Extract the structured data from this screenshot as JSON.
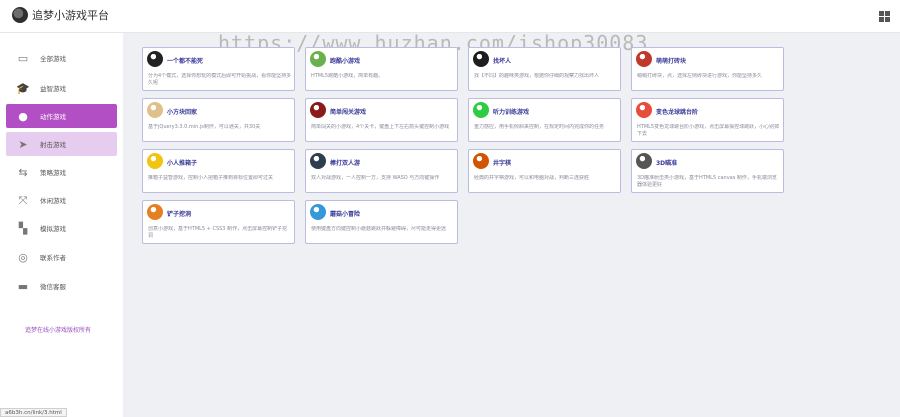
{
  "app": {
    "title": "追梦小游戏平台"
  },
  "watermark": "https://www.huzhan.com/ishop30083",
  "sidebar": {
    "items": [
      {
        "label": "全部游戏",
        "icon": "chat-bubble-icon",
        "glyph": "▭"
      },
      {
        "label": "益智游戏",
        "icon": "graduation-cap-icon",
        "glyph": "🎓"
      },
      {
        "label": "动作游戏",
        "icon": "alien-icon",
        "glyph": "●"
      },
      {
        "label": "射击游戏",
        "icon": "rocket-icon",
        "glyph": "➤"
      },
      {
        "label": "策略游戏",
        "icon": "swap-icon",
        "glyph": "⇆"
      },
      {
        "label": "休闲游戏",
        "icon": "cross-icon",
        "glyph": "⤧"
      },
      {
        "label": "模拟游戏",
        "icon": "blocks-icon",
        "glyph": "▚"
      },
      {
        "label": "联系作者",
        "icon": "user-icon",
        "glyph": "◎"
      },
      {
        "label": "微信客服",
        "icon": "keyboard-icon",
        "glyph": "▬"
      }
    ],
    "active_index": 2,
    "hover_index": 3,
    "footer": "追梦在线小游戏版权所有"
  },
  "games": [
    {
      "title": "一个都不能死",
      "desc": "分为4个模式，选择你想玩的模式后即可开始挑战，看你能坚持多久呢",
      "color": "#222222",
      "icon": "stickman-icon"
    },
    {
      "title": "跑酷小游戏",
      "desc": "HTML5跑酷小游戏，简单有趣。",
      "color": "#6ab04c",
      "icon": "runner-icon"
    },
    {
      "title": "找坏人",
      "desc": "找【不同】的趣味类游戏，根据你仔细的观察力找出坏人",
      "color": "#1e1e1e",
      "icon": "badguy-icon"
    },
    {
      "title": "萌萌打砖块",
      "desc": "萌萌打砖块，点，选择左侧砖块进行游戏，你能坚持多久",
      "color": "#c0392b",
      "icon": "brick-icon"
    },
    {
      "title": "小方块回家",
      "desc": "基于jQuery3.3.0.min.js制作，可以通关，共30关",
      "color": "#e0c08a",
      "icon": "cube-icon"
    },
    {
      "title": "简单闯关游戏",
      "desc": "简单闯关的小游戏，4个关卡，键盘上下左右箭头键控制小游戏",
      "color": "#8b1a1a",
      "icon": "stage-icon"
    },
    {
      "title": "听力训练游戏",
      "desc": "重力感应，用手机倾斜来控制，在规定时间内完成你的任务",
      "color": "#2ecc40",
      "icon": "ear-icon"
    },
    {
      "title": "变色龙球跳台阶",
      "desc": "HTML5变色龙球跳台阶小游戏，点击屏幕操控球跳跃，小心别掉下去",
      "color": "#e74c3c",
      "icon": "ball-icon"
    },
    {
      "title": "小人推箱子",
      "desc": "推箱子益智游戏，控制小人把箱子推到目标位置即可过关",
      "color": "#f1c40f",
      "icon": "worker-icon"
    },
    {
      "title": "棒打双人游",
      "desc": "双人对战游戏，一人控制一方，支持 WASD 与方向键操作",
      "color": "#2c3e50",
      "icon": "bat-icon"
    },
    {
      "title": "井字棋",
      "desc": "经典的井字棋游戏，可以和电脑对战，判断三连获胜",
      "color": "#d35400",
      "icon": "grid-icon"
    },
    {
      "title": "3D瞄准",
      "desc": "3D瞄准射击类小游戏，基于HTML5 canvas 制作，手机端浏览器体验更好",
      "color": "#555555",
      "icon": "target-icon"
    },
    {
      "title": "铲子挖洞",
      "desc": "创意小游戏，基于HTML5 + CSS3 制作，点击屏幕控制铲子挖洞",
      "color": "#e67e22",
      "icon": "shovel-icon"
    },
    {
      "title": "蘑菇小冒险",
      "desc": "使用键盘方向键控制小蘑菇跳跃并躲避障碍，尽可能走得更远",
      "color": "#3498db",
      "icon": "mushroom-icon"
    }
  ],
  "statusbar": {
    "url": "a6b3h.cn/link/3.html"
  }
}
